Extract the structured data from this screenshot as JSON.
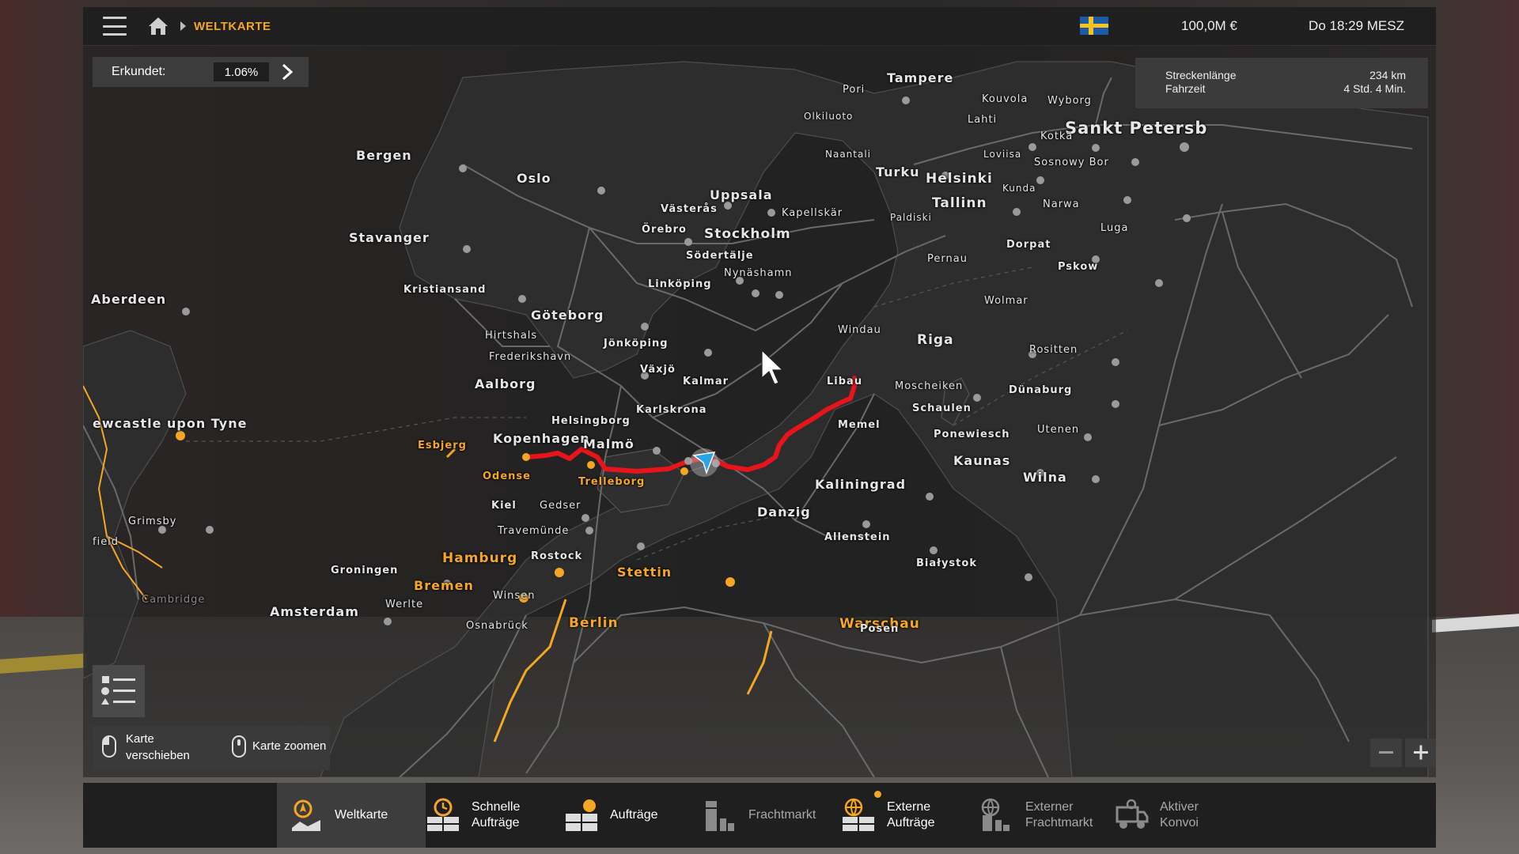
{
  "header": {
    "breadcrumb": "WELTKARTE",
    "money": "100,0M €",
    "datetime": "Do 18:29 MESZ",
    "flag": "sweden-flag"
  },
  "explored": {
    "label": "Erkundet:",
    "value": "1.06%"
  },
  "route": {
    "length_label": "Streckenlänge",
    "length_value": "234 km",
    "time_label": "Fahrzeit",
    "time_value": "4 Std. 4 Min."
  },
  "hints": {
    "pan": "Karte\nverschieben",
    "zoom": "Karte zoomen"
  },
  "zoom": {
    "minus": "−",
    "plus": "+"
  },
  "map": {
    "route_color": "#e8141c",
    "accent_color": "#f5a623",
    "cities": [
      {
        "name": "Bergen"
      },
      {
        "name": "Oslo"
      },
      {
        "name": "Uppsala"
      },
      {
        "name": "Västerås"
      },
      {
        "name": "Örebro"
      },
      {
        "name": "Stockholm"
      },
      {
        "name": "Södertälje"
      },
      {
        "name": "Nynäshamn"
      },
      {
        "name": "Kapellskär"
      },
      {
        "name": "Stavanger"
      },
      {
        "name": "Kristiansand"
      },
      {
        "name": "Linköping"
      },
      {
        "name": "Göteborg"
      },
      {
        "name": "Jönköping"
      },
      {
        "name": "Hirtshals"
      },
      {
        "name": "Frederikshavn"
      },
      {
        "name": "Växjö"
      },
      {
        "name": "Kalmar"
      },
      {
        "name": "Aalborg"
      },
      {
        "name": "Karlskrona"
      },
      {
        "name": "Helsingborg"
      },
      {
        "name": "Kopenhagen"
      },
      {
        "name": "Malmö"
      },
      {
        "name": "Esbjerg"
      },
      {
        "name": "Odense"
      },
      {
        "name": "Trelleborg"
      },
      {
        "name": "Kiel"
      },
      {
        "name": "Gedser"
      },
      {
        "name": "Travemünde"
      },
      {
        "name": "Rostock"
      },
      {
        "name": "Hamburg"
      },
      {
        "name": "Bremen"
      },
      {
        "name": "Groningen"
      },
      {
        "name": "Winsen"
      },
      {
        "name": "Werlte"
      },
      {
        "name": "Amsterdam"
      },
      {
        "name": "Stettin"
      },
      {
        "name": "Berlin"
      },
      {
        "name": "Danzig"
      },
      {
        "name": "Allenstein"
      },
      {
        "name": "Białystok"
      },
      {
        "name": "Warschau"
      },
      {
        "name": "Kaliningrad"
      },
      {
        "name": "Memel"
      },
      {
        "name": "Libau"
      },
      {
        "name": "Windau"
      },
      {
        "name": "Riga"
      },
      {
        "name": "Rositten"
      },
      {
        "name": "Moscheiken"
      },
      {
        "name": "Schaulen"
      },
      {
        "name": "Dünaburg"
      },
      {
        "name": "Ponewiesch"
      },
      {
        "name": "Utenen"
      },
      {
        "name": "Kaunas"
      },
      {
        "name": "Wilna"
      },
      {
        "name": "Tampere"
      },
      {
        "name": "Pori"
      },
      {
        "name": "Kouvola"
      },
      {
        "name": "Wyborg"
      },
      {
        "name": "Olkiluoto"
      },
      {
        "name": "Lahti"
      },
      {
        "name": "Sankt Petersb"
      },
      {
        "name": "Kotka"
      },
      {
        "name": "Naantali"
      },
      {
        "name": "Loviisa"
      },
      {
        "name": "Turku"
      },
      {
        "name": "Helsinki"
      },
      {
        "name": "Sosnowy Bor"
      },
      {
        "name": "Tallinn"
      },
      {
        "name": "Kunda"
      },
      {
        "name": "Narwa"
      },
      {
        "name": "Paldiski"
      },
      {
        "name": "Luga"
      },
      {
        "name": "Pernau"
      },
      {
        "name": "Dorpat"
      },
      {
        "name": "Pskow"
      },
      {
        "name": "Wolmar"
      },
      {
        "name": "Aberdeen"
      },
      {
        "name": "ewcastle upon Tyne"
      },
      {
        "name": "Grimsby"
      },
      {
        "name": "field"
      },
      {
        "name": "Posen"
      },
      {
        "name": "Osnabrück"
      },
      {
        "name": "Cambridge"
      }
    ]
  },
  "tabs": [
    {
      "label": "Weltkarte",
      "icon": "world-map-icon"
    },
    {
      "label": "Schnelle\nAufträge",
      "icon": "quick-jobs-icon"
    },
    {
      "label": "Aufträge",
      "icon": "jobs-icon"
    },
    {
      "label": "Frachtmarkt",
      "icon": "freight-market-icon"
    },
    {
      "label": "Externe\nAufträge",
      "icon": "external-jobs-icon"
    },
    {
      "label": "Externer\nFrachtmarkt",
      "icon": "external-freight-market-icon"
    },
    {
      "label": "Aktiver\nKonvoi",
      "icon": "active-convoy-icon"
    }
  ]
}
